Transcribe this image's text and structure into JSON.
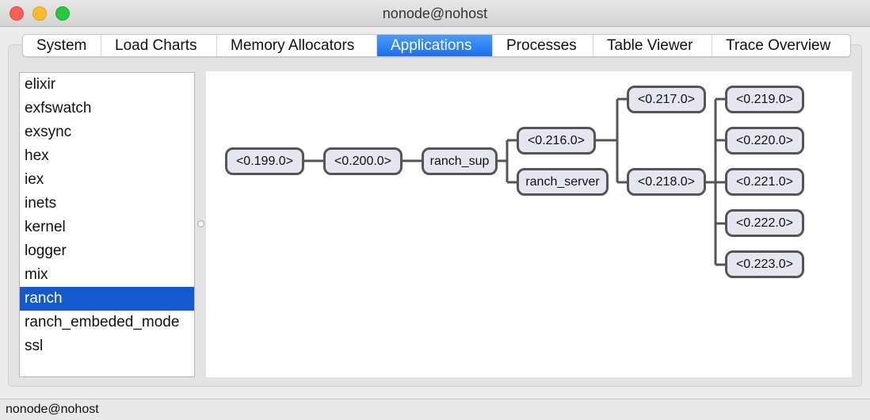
{
  "window": {
    "title": "nonode@nohost"
  },
  "tabs": [
    {
      "label": "System"
    },
    {
      "label": "Load Charts"
    },
    {
      "label": "Memory Allocators"
    },
    {
      "label": "Applications",
      "active": true
    },
    {
      "label": "Processes"
    },
    {
      "label": "Table Viewer"
    },
    {
      "label": "Trace Overview"
    }
  ],
  "applications": [
    "elixir",
    "exfswatch",
    "exsync",
    "hex",
    "iex",
    "inets",
    "kernel",
    "logger",
    "mix",
    "ranch",
    "ranch_embeded_mode",
    "ssl"
  ],
  "selected_application": "ranch",
  "tree": {
    "n199": "<0.199.0>",
    "n200": "<0.200.0>",
    "ranch_sup": "ranch_sup",
    "n216": "<0.216.0>",
    "ranch_server": "ranch_server",
    "n217": "<0.217.0>",
    "n218": "<0.218.0>",
    "n219": "<0.219.0>",
    "n220": "<0.220.0>",
    "n221": "<0.221.0>",
    "n222": "<0.222.0>",
    "n223": "<0.223.0>"
  },
  "status": "nonode@nohost",
  "colors": {
    "accent": "#1c6ff0",
    "selection": "#1559cf",
    "node_fill": "#e6e6f0",
    "node_border": "#555555"
  }
}
